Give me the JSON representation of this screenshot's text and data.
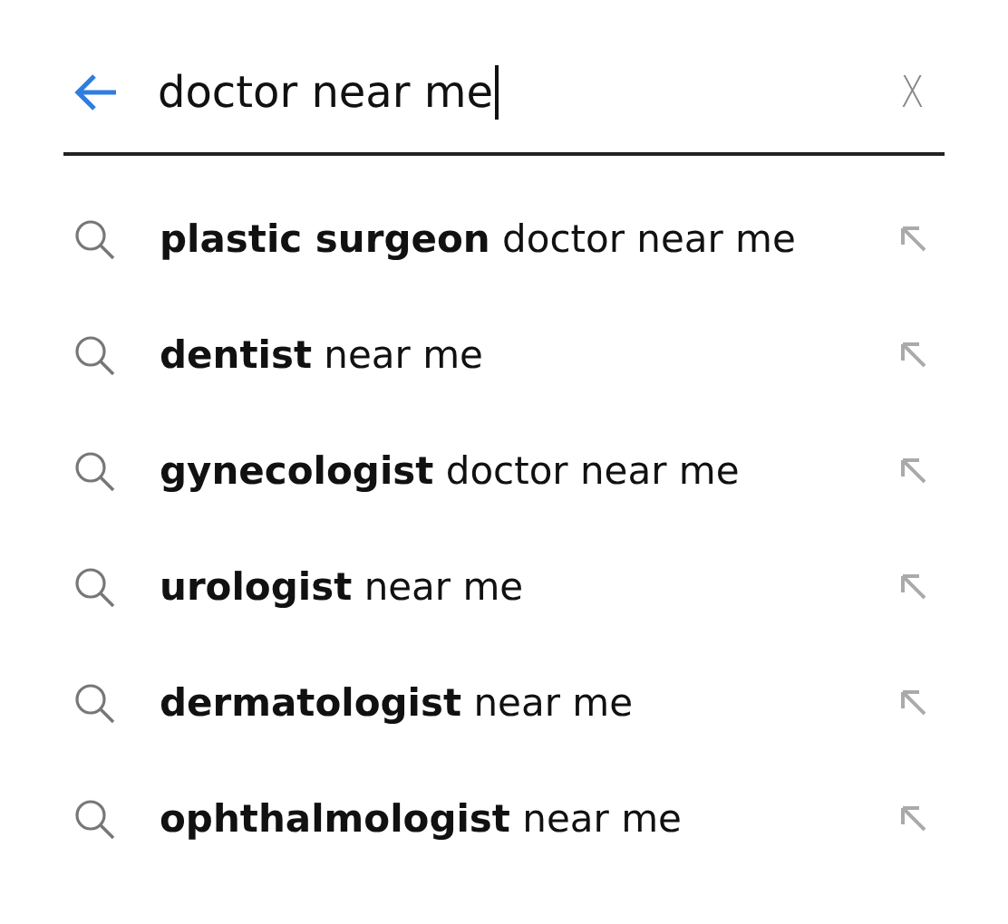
{
  "search": {
    "value": "doctor near me",
    "clear_label": "X"
  },
  "suggestions": [
    {
      "text": "**plastic surgeon** doctor near me"
    },
    {
      "text": "**dentist** near me"
    },
    {
      "text": "**gynecologist** doctor near me"
    },
    {
      "text": "**urologist** near me"
    },
    {
      "text": "**dermatologist** near me"
    },
    {
      "text": "**ophthalmologist** near me"
    }
  ]
}
